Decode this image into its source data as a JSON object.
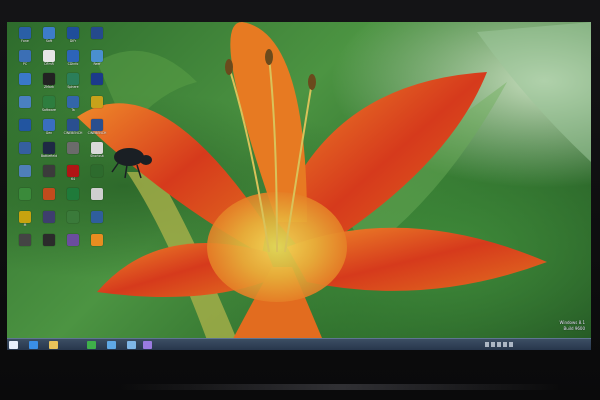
{
  "desktop": {
    "icons": [
      {
        "label": "Fone",
        "color": "#2a5fa6",
        "icon": "app-icon"
      },
      {
        "label": "Soft",
        "color": "#3d7cc9",
        "icon": "app-icon"
      },
      {
        "label": "DiFr",
        "color": "#1f4e9a",
        "icon": "app-icon"
      },
      {
        "label": "",
        "color": "#254a8c",
        "icon": "app-icon"
      },
      {
        "label": "PC",
        "color": "#3b6fb5",
        "icon": "computer-icon"
      },
      {
        "label": "DFmR",
        "color": "#e6e6e6",
        "icon": "app-icon"
      },
      {
        "label": "CDinfo",
        "color": "#2d64b8",
        "icon": "app-icon"
      },
      {
        "label": "Reef",
        "color": "#4a8fd0",
        "icon": "app-icon"
      },
      {
        "label": "",
        "color": "#3a78c8",
        "icon": "network-icon"
      },
      {
        "label": "ZMark",
        "color": "#222222",
        "icon": "app-icon"
      },
      {
        "label": "Sphere",
        "color": "#2b7e5a",
        "icon": "app-icon"
      },
      {
        "label": "",
        "color": "#1b3a8a",
        "icon": "app-icon"
      },
      {
        "label": "",
        "color": "#4a80c0",
        "icon": "folder-icon"
      },
      {
        "label": "Software",
        "color": "#2d7d3e",
        "icon": "app-icon"
      },
      {
        "label": "Ta",
        "color": "#3366aa",
        "icon": "app-icon"
      },
      {
        "label": "",
        "color": "#c8a21a",
        "icon": "app-icon"
      },
      {
        "label": "",
        "color": "#2255a0",
        "icon": "app-icon"
      },
      {
        "label": "Gen",
        "color": "#3a6ebf",
        "icon": "app-icon"
      },
      {
        "label": "CINEBENCH",
        "color": "#2a4f8f",
        "icon": "app-icon"
      },
      {
        "label": "CINEBENCH",
        "color": "#2a4f8f",
        "icon": "app-icon"
      },
      {
        "label": "",
        "color": "#355f9e",
        "icon": "app-icon"
      },
      {
        "label": "Battlefield",
        "color": "#1e2a44",
        "icon": "game-icon"
      },
      {
        "label": "",
        "color": "#6b6b6b",
        "icon": "app-icon"
      },
      {
        "label": "Shortcut",
        "color": "#d9d9d9",
        "icon": "app-icon"
      },
      {
        "label": "",
        "color": "#4f7fb8",
        "icon": "app-icon"
      },
      {
        "label": "",
        "color": "#3b3b3b",
        "icon": "app-icon"
      },
      {
        "label": "64",
        "color": "#b01515",
        "icon": "app-icon"
      },
      {
        "label": "",
        "color": "#2d6b2d",
        "icon": "app-icon"
      },
      {
        "label": "",
        "color": "#3a8a3a",
        "icon": "app-icon"
      },
      {
        "label": "",
        "color": "#c24b1d",
        "icon": "app-icon"
      },
      {
        "label": "",
        "color": "#1f7a3a",
        "icon": "app-icon"
      },
      {
        "label": "",
        "color": "#cfcfcf",
        "icon": "app-icon"
      },
      {
        "label": "M",
        "color": "#c7a30f",
        "icon": "app-icon"
      },
      {
        "label": "",
        "color": "#3e3e6e",
        "icon": "app-icon"
      },
      {
        "label": "",
        "color": "#3a7a3a",
        "icon": "app-icon"
      },
      {
        "label": "",
        "color": "#2f5e9c",
        "icon": "app-icon"
      },
      {
        "label": "",
        "color": "#444444",
        "icon": "app-icon"
      },
      {
        "label": "",
        "color": "#2b2b2b",
        "icon": "app-icon"
      },
      {
        "label": "",
        "color": "#6b4d9e",
        "icon": "app-icon"
      },
      {
        "label": "",
        "color": "#e88d20",
        "icon": "app-icon"
      }
    ]
  },
  "watermark": {
    "line1": "Windows 8.1",
    "line2": "Build 9600"
  },
  "clock": {
    "time": "",
    "date": ""
  },
  "taskbar": {
    "items": [
      {
        "name": "start-button",
        "color": "#e8f0fb"
      },
      {
        "name": "ie-icon",
        "color": "#3a8ee6"
      },
      {
        "name": "explorer-icon",
        "color": "#e8c25a"
      },
      {
        "name": "store-icon",
        "color": "#3fb04a"
      },
      {
        "name": "app-icon",
        "color": "#5fa8e6"
      },
      {
        "name": "app-icon",
        "color": "#7fb7e8"
      },
      {
        "name": "app-icon",
        "color": "#9a7be0"
      }
    ]
  }
}
